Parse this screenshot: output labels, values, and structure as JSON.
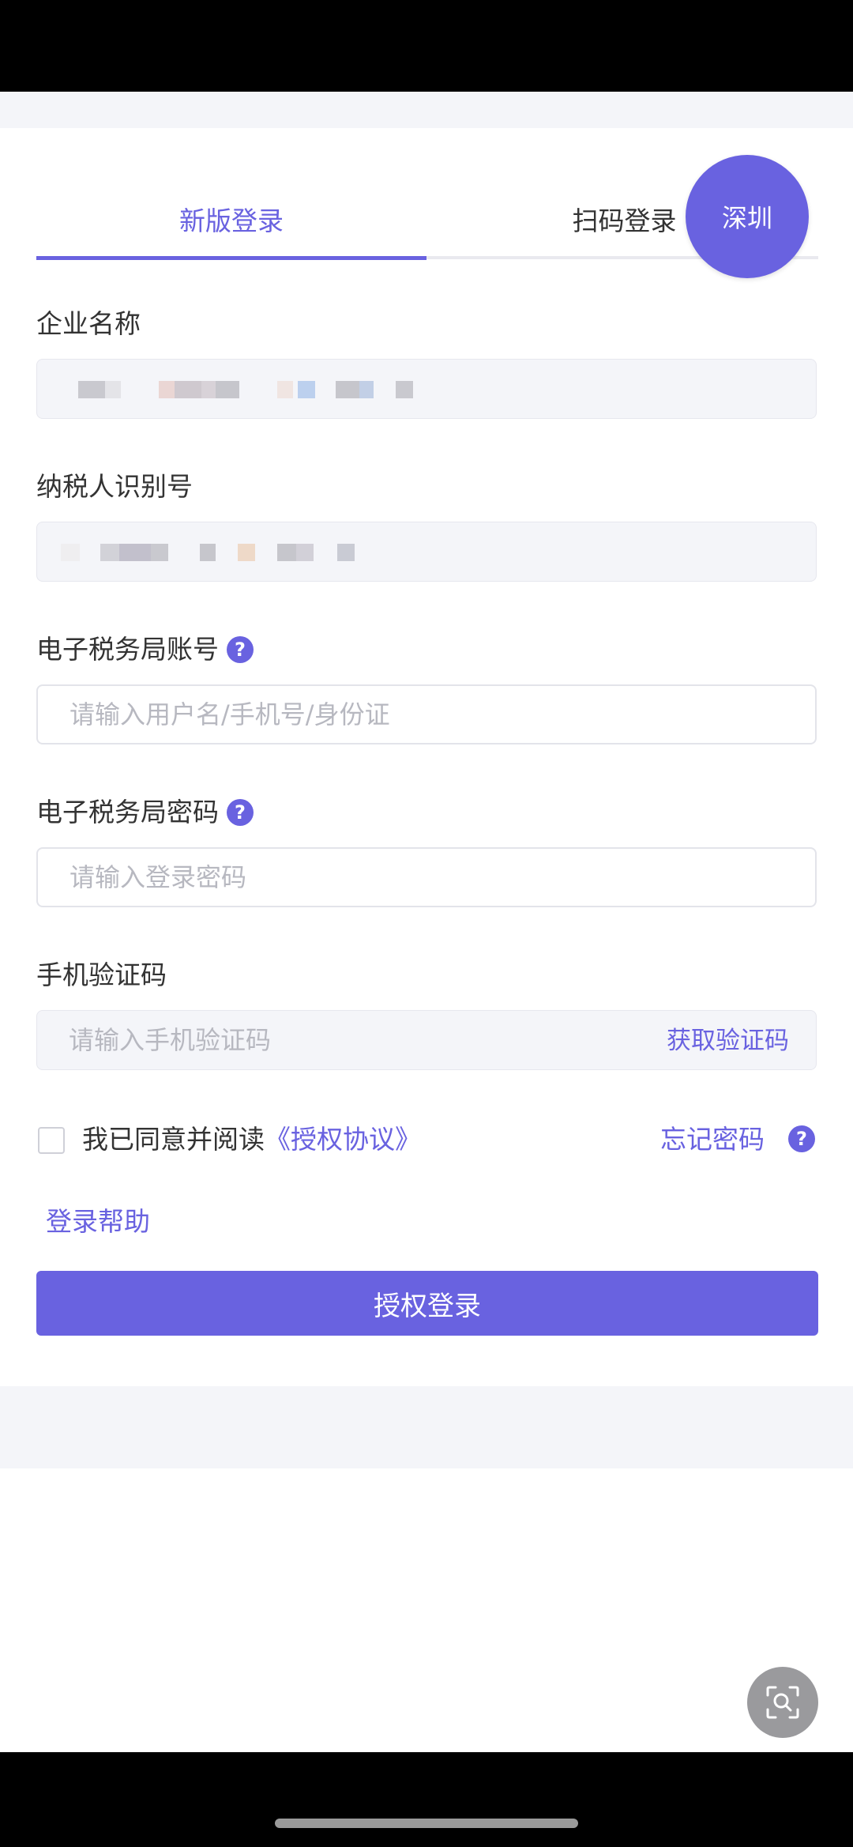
{
  "tabs": {
    "new_login": "新版登录",
    "scan_login": "扫码登录"
  },
  "region_badge": "深圳",
  "fields": {
    "company_name": {
      "label": "企业名称"
    },
    "taxpayer_id": {
      "label": "纳税人识别号"
    },
    "account": {
      "label": "电子税务局账号",
      "placeholder": "请输入用户名/手机号/身份证"
    },
    "password": {
      "label": "电子税务局密码",
      "placeholder": "请输入登录密码"
    },
    "sms_code": {
      "label": "手机验证码",
      "placeholder": "请输入手机验证码",
      "action": "获取验证码"
    }
  },
  "agreement": {
    "text": "我已同意并阅读",
    "link": "《授权协议》"
  },
  "forgot_password": "忘记密码",
  "help_glyph": "?",
  "login_help": "登录帮助",
  "submit_label": "授权登录",
  "colors": {
    "accent": "#6962e0",
    "field_bg": "#f4f5f9",
    "placeholder": "#b7b8c0"
  },
  "icons": [
    "question-icon",
    "scan-search-icon"
  ]
}
